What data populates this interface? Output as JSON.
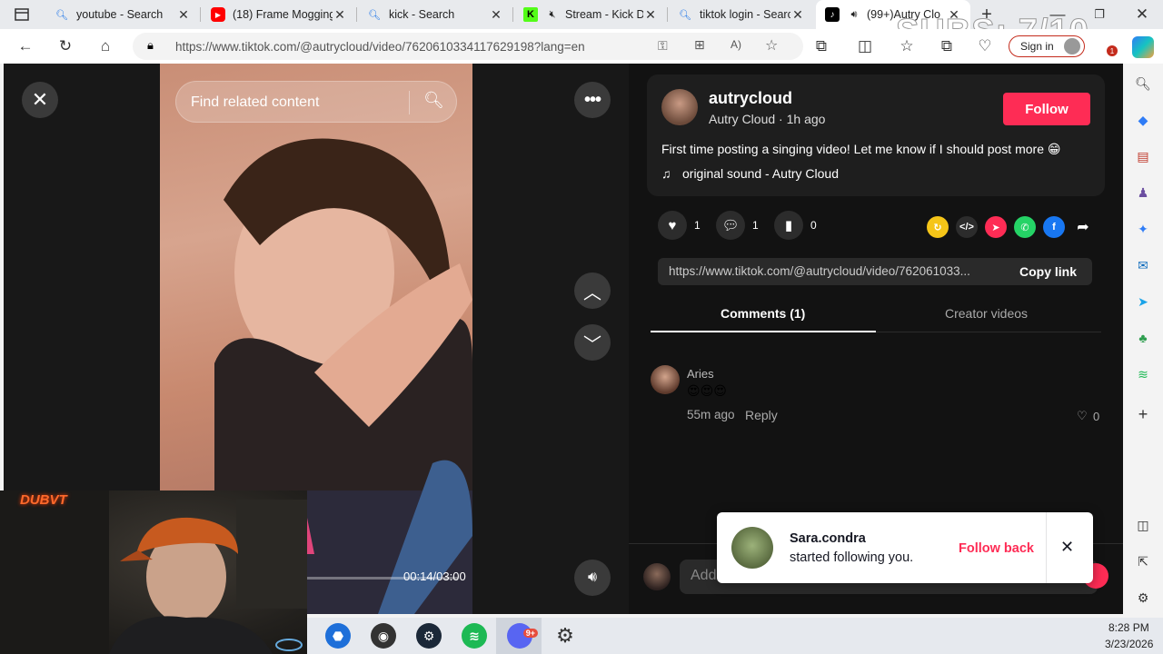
{
  "browser": {
    "tabs": [
      {
        "title": "youtube - Search",
        "icon": "search-icon"
      },
      {
        "title": "(18) Frame Mogging",
        "icon": "youtube-icon"
      },
      {
        "title": "kick - Search",
        "icon": "search-icon"
      },
      {
        "title": "Stream - Kick D",
        "icon": "kick-icon"
      },
      {
        "title": "tiktok login - Search",
        "icon": "search-icon"
      },
      {
        "title": "(99+)Autry Clo",
        "icon": "tiktok-icon"
      }
    ],
    "url": "https://www.tiktok.com/@autrycloud/video/7620610334117629198?lang=en",
    "sign_in": "Sign in",
    "overlay_text": "SUBS: 7/10"
  },
  "video": {
    "search_placeholder": "Find related content",
    "time": "00:14/03:00",
    "progress": 0.078
  },
  "post": {
    "username": "autrycloud",
    "display_name": "Autry Cloud",
    "posted": "1h ago",
    "separator": "·",
    "follow_label": "Follow",
    "caption": "First time posting a singing video! Let me know if I should post more 😁",
    "sound": "original sound - Autry Cloud",
    "likes": "1",
    "comments": "1",
    "saves": "0",
    "link": "https://www.tiktok.com/@autrycloud/video/762061033...",
    "copy_label": "Copy link"
  },
  "tabs": {
    "comments": "Comments (1)",
    "creator": "Creator videos"
  },
  "comment": {
    "author": "Aries",
    "text": "😍😍😍",
    "time": "55m ago",
    "reply": "Reply",
    "likes": "0"
  },
  "add_comment_placeholder": "Add",
  "toast": {
    "name": "Sara.condra",
    "message": "started following you.",
    "action": "Follow back"
  },
  "webcam_label": "DUBVT",
  "taskbar": {
    "time": "8:28 PM",
    "date": "3/23/2026",
    "badge": "9+"
  },
  "colors": {
    "tiktok_red": "#fe2c55",
    "bg": "#121212",
    "panel": "#1e1e1e"
  }
}
